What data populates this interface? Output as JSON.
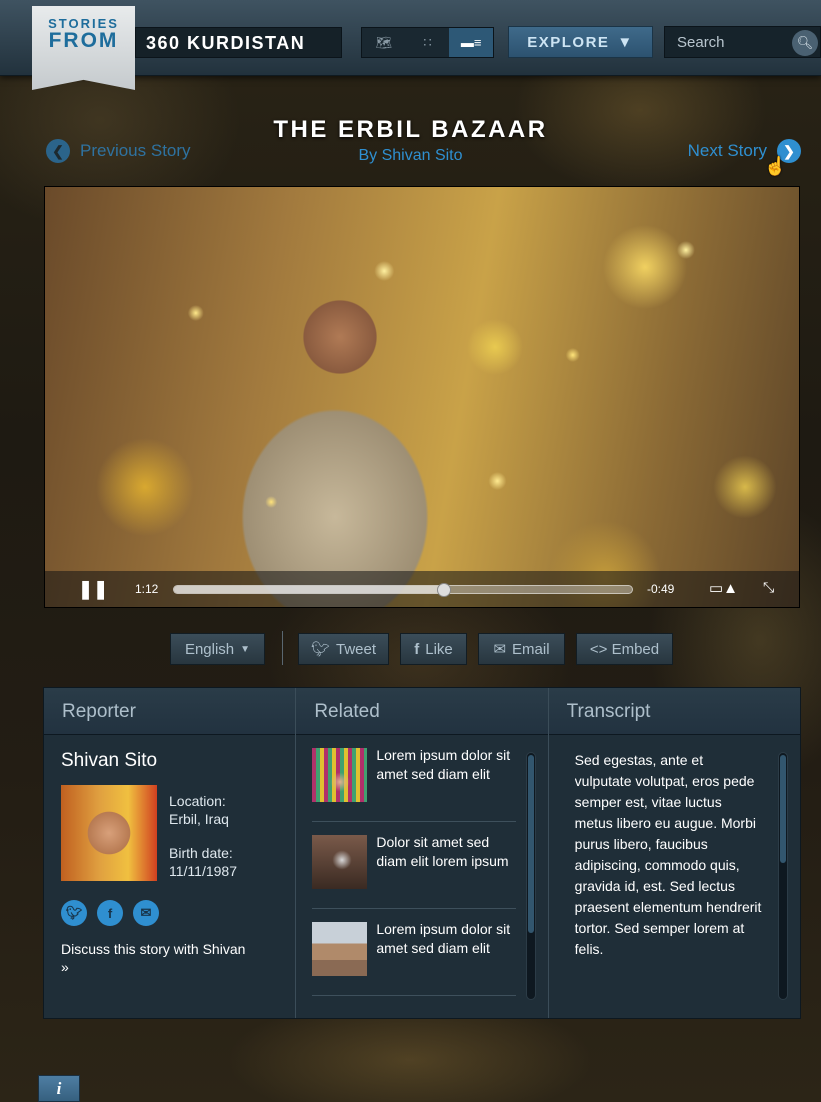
{
  "header": {
    "ribbon_top": "STORIES",
    "ribbon_bottom": "FROM",
    "brand": "360 KURDISTAN",
    "view_icons": [
      "map-icon",
      "grid-icon",
      "list-icon"
    ],
    "active_view": "list",
    "explore_label": "EXPLORE",
    "search_placeholder": "Search"
  },
  "story": {
    "title": "THE ERBIL BAZAAR",
    "byline": "By Shivan Sito",
    "prev_label": "Previous Story",
    "next_label": "Next Story"
  },
  "player": {
    "elapsed": "1:12",
    "remaining": "-0:49",
    "progress": 0.59,
    "state": "playing"
  },
  "actions": {
    "language": "English",
    "tweet": "Tweet",
    "like": "Like",
    "email": "Email",
    "embed": "<> Embed"
  },
  "reporter": {
    "header": "Reporter",
    "name": "Shivan Sito",
    "location_label": "Location:",
    "location_value": "Erbil, Iraq",
    "birth_label": "Birth date:",
    "birth_value": "11/11/1987",
    "discuss": "Discuss this story with Shivan »"
  },
  "related": {
    "header": "Related",
    "items": [
      {
        "text": "Lorem ipsum dolor sit amet sed diam elit"
      },
      {
        "text": "Dolor sit amet sed diam elit lorem ipsum"
      },
      {
        "text": "Lorem ipsum dolor sit amet sed diam elit"
      }
    ]
  },
  "transcript": {
    "header": "Transcript",
    "text": "Sed egestas, ante et vulputate volutpat, eros pede semper est, vitae luctus metus libero eu augue. Morbi purus libero, faucibus adipiscing, commodo quis, gravida id, est. Sed lectus praesent elementum hendrerit tortor. Sed semper lorem at felis."
  },
  "footer": {
    "info": "i"
  },
  "colors": {
    "accent": "#2f8fd0",
    "panel": "#1f2e38",
    "header_bar": "#2c3f4c"
  }
}
